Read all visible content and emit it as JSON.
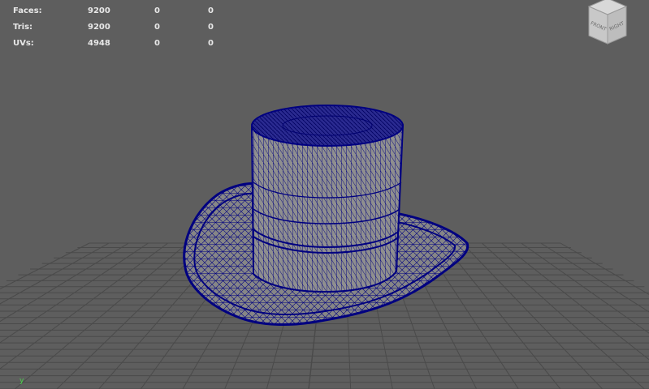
{
  "hud": {
    "rows": [
      {
        "label": "Faces:",
        "values": [
          "9200",
          "0",
          "0"
        ]
      },
      {
        "label": "Tris:",
        "values": [
          "9200",
          "0",
          "0"
        ]
      },
      {
        "label": "UVs:",
        "values": [
          "4948",
          "0",
          "0"
        ]
      }
    ]
  },
  "viewcube": {
    "front_label": "FRONT",
    "right_label": "RIGHT"
  },
  "axis": {
    "y_label": "y"
  },
  "colors": {
    "viewport_bg": "#5e5e5e",
    "grid": "#4a4a4a",
    "wireframe": "#000080",
    "mesh_fill": "#8c8c8c",
    "hud_text": "#e8e8e8"
  }
}
